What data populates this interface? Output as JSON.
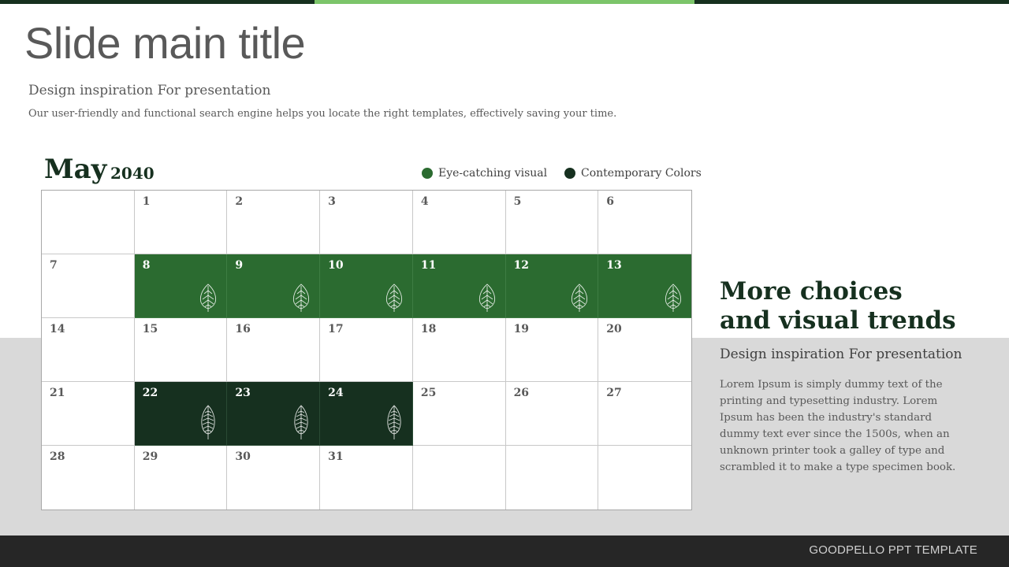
{
  "slide": {
    "title": "Slide main title",
    "subtitle": "Design inspiration For presentation",
    "description": "Our user-friendly and functional search engine helps you locate the right templates, effectively saving your time."
  },
  "calendar": {
    "month": "May",
    "year": "2040",
    "legend": [
      {
        "label": "Eye-catching visual",
        "color": "#2b6b30"
      },
      {
        "label": "Contemporary Colors",
        "color": "#16301f"
      }
    ],
    "cells": [
      {
        "day": "",
        "style": ""
      },
      {
        "day": "1",
        "style": ""
      },
      {
        "day": "2",
        "style": ""
      },
      {
        "day": "3",
        "style": ""
      },
      {
        "day": "4",
        "style": ""
      },
      {
        "day": "5",
        "style": ""
      },
      {
        "day": "6",
        "style": ""
      },
      {
        "day": "7",
        "style": ""
      },
      {
        "day": "8",
        "style": "light",
        "icon": "leaf-icon"
      },
      {
        "day": "9",
        "style": "light",
        "icon": "leaf-icon"
      },
      {
        "day": "10",
        "style": "light",
        "icon": "leaf-icon"
      },
      {
        "day": "11",
        "style": "light",
        "icon": "leaf-icon"
      },
      {
        "day": "12",
        "style": "light",
        "icon": "leaf-icon"
      },
      {
        "day": "13",
        "style": "light",
        "icon": "leaf-icon"
      },
      {
        "day": "14",
        "style": ""
      },
      {
        "day": "15",
        "style": ""
      },
      {
        "day": "16",
        "style": ""
      },
      {
        "day": "17",
        "style": ""
      },
      {
        "day": "18",
        "style": ""
      },
      {
        "day": "19",
        "style": ""
      },
      {
        "day": "20",
        "style": ""
      },
      {
        "day": "21",
        "style": ""
      },
      {
        "day": "22",
        "style": "dark",
        "icon": "feather-leaf-icon"
      },
      {
        "day": "23",
        "style": "dark",
        "icon": "feather-leaf-icon"
      },
      {
        "day": "24",
        "style": "dark",
        "icon": "feather-leaf-icon"
      },
      {
        "day": "25",
        "style": ""
      },
      {
        "day": "26",
        "style": ""
      },
      {
        "day": "27",
        "style": ""
      },
      {
        "day": "28",
        "style": ""
      },
      {
        "day": "29",
        "style": ""
      },
      {
        "day": "30",
        "style": ""
      },
      {
        "day": "31",
        "style": ""
      },
      {
        "day": "",
        "style": ""
      },
      {
        "day": "",
        "style": ""
      },
      {
        "day": "",
        "style": ""
      }
    ]
  },
  "side": {
    "heading_line1": "More choices",
    "heading_line2": "and visual trends",
    "subheading": "Design inspiration For presentation",
    "body": "Lorem Ipsum is simply dummy text of the printing and typesetting industry. Lorem Ipsum has been the industry's standard dummy text ever since the 1500s, when an unknown printer took a galley of type and scrambled it to make a type specimen book."
  },
  "footer": {
    "text": "GOODPELLO  PPT TEMPLATE"
  }
}
